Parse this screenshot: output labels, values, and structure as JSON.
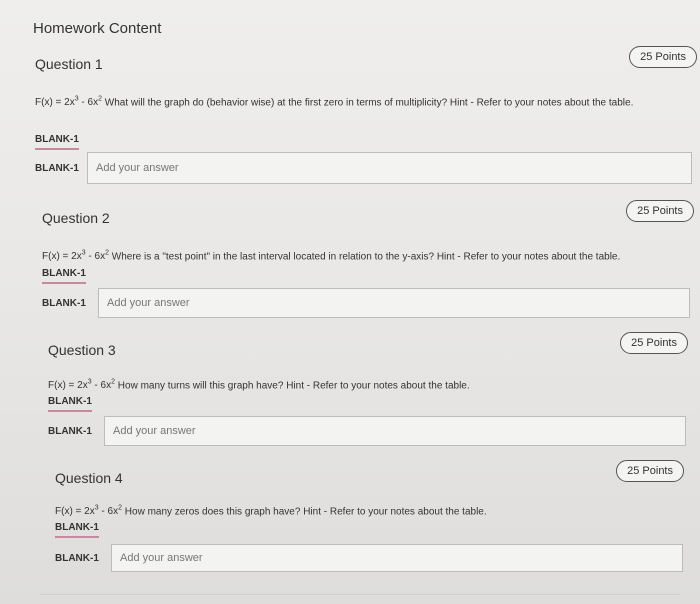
{
  "page": {
    "heading": "Homework Content"
  },
  "questions": [
    {
      "title": "Question 1",
      "points": "25 Points",
      "prompt_text": "What will the graph do (behavior wise) at the first zero in terms of multiplicity? Hint - Refer to your notes about the table.",
      "blank_tag": "BLANK-1",
      "answer_label": "BLANK-1",
      "answer_placeholder": "Add your answer"
    },
    {
      "title": "Question 2",
      "points": "25 Points",
      "prompt_text": "Where is a \"test point\" in the last interval located in relation to the y-axis? Hint - Refer to your notes about the table.",
      "blank_tag": "BLANK-1",
      "answer_label": "BLANK-1",
      "answer_placeholder": "Add your answer"
    },
    {
      "title": "Question 3",
      "points": "25 Points",
      "prompt_text": "How many turns will this graph have? Hint - Refer to your notes about the table.",
      "blank_tag": "BLANK-1",
      "answer_label": "BLANK-1",
      "answer_placeholder": "Add your answer"
    },
    {
      "title": "Question 4",
      "points": "25 Points",
      "prompt_text": "How many zeros does this graph have? Hint - Refer to your notes about the table.",
      "blank_tag": "BLANK-1",
      "answer_label": "BLANK-1",
      "answer_placeholder": "Add your answer"
    }
  ],
  "equation": {
    "lhs": "F(x) = 2x",
    "exp1": "3",
    "mid": " - 6x",
    "exp2": "2"
  }
}
